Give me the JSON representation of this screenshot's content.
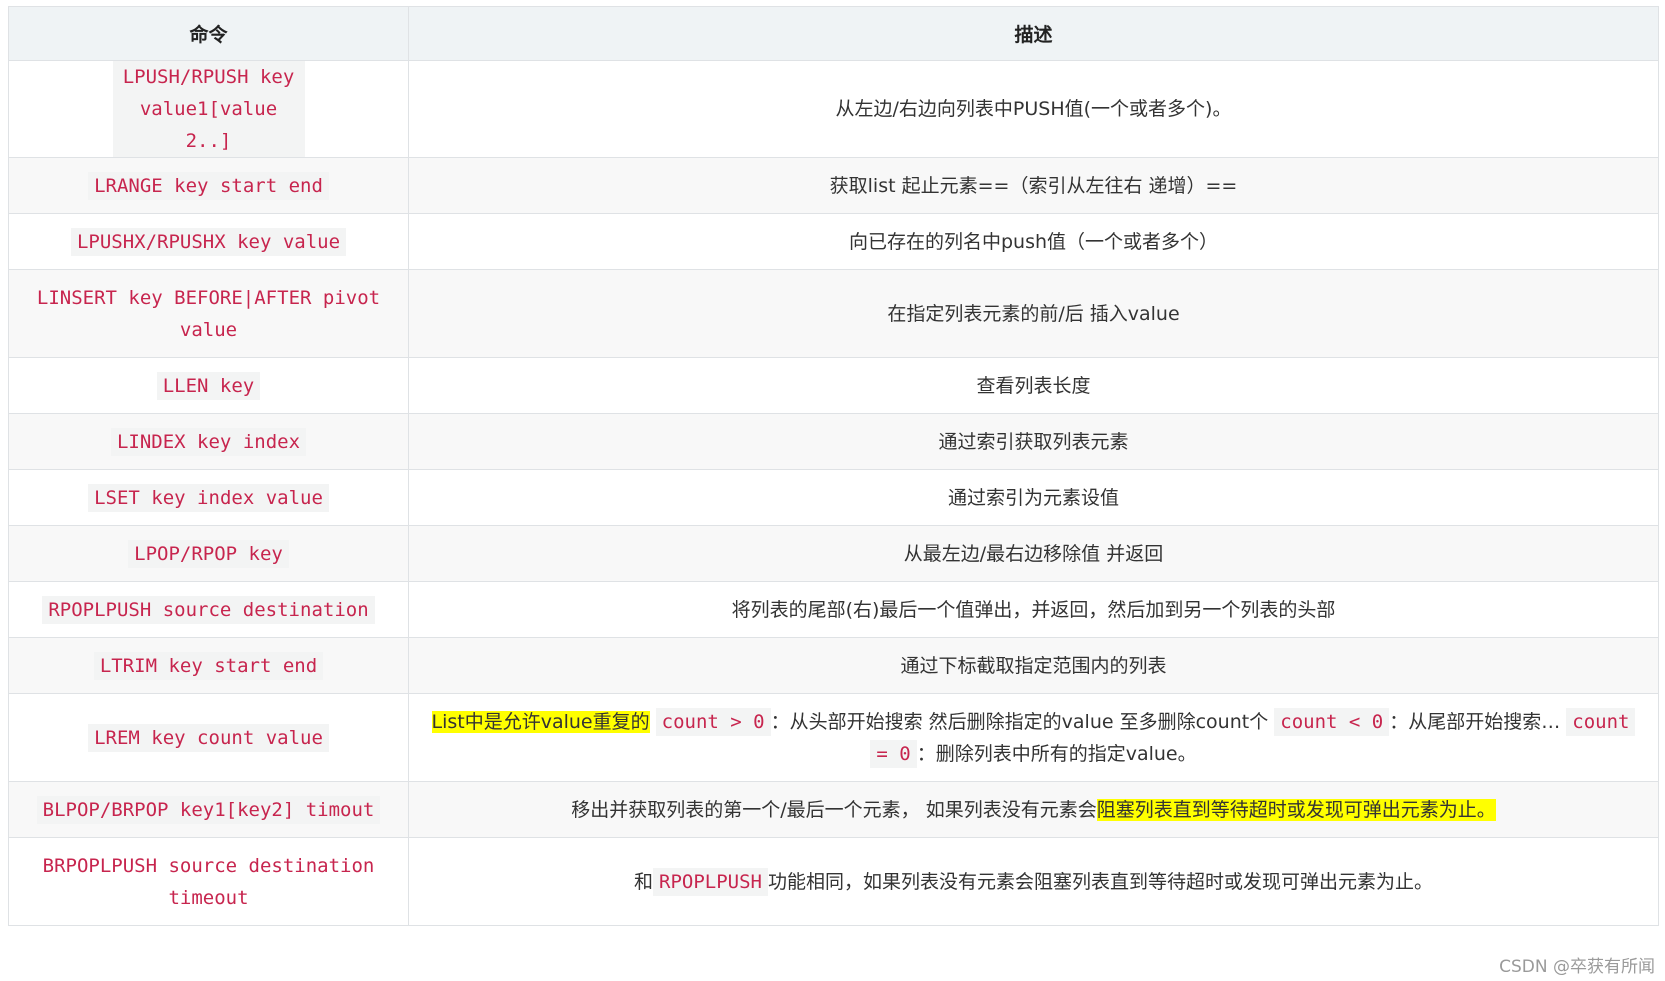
{
  "headers": {
    "command": "命令",
    "description": "描述"
  },
  "rows": [
    {
      "command": "LPUSH/RPUSH key value1[value2..]",
      "description": "从左边/右边向列表中PUSH值(一个或者多个)。"
    },
    {
      "command": "LRANGE key start end",
      "description": "获取list 起止元素==（索引从左往右 递增）=="
    },
    {
      "command": "LPUSHX/RPUSHX key value",
      "description": "向已存在的列名中push值（一个或者多个）"
    },
    {
      "command": "LINSERT key BEFORE|AFTER pivot value",
      "description": "在指定列表元素的前/后 插入value"
    },
    {
      "command": "LLEN key",
      "description": "查看列表长度"
    },
    {
      "command": "LINDEX key index",
      "description": "通过索引获取列表元素"
    },
    {
      "command": "LSET key index value",
      "description": "通过索引为元素设值"
    },
    {
      "command": "LPOP/RPOP key",
      "description": "从最左边/最右边移除值 并返回"
    },
    {
      "command": "RPOPLPUSH source destination",
      "description": "将列表的尾部(右)最后一个值弹出，并返回，然后加到另一个列表的头部"
    },
    {
      "command": "LTRIM key start end",
      "description": "通过下标截取指定范围内的列表"
    },
    {
      "command": "LREM key count value",
      "desc_parts": {
        "highlight": "List中是允许value重复的",
        "code1": "count > 0",
        "text1": "：从头部开始搜索 然后删除指定的value 至多删除count个",
        "code2": "count < 0",
        "text2": "：从尾部开始搜索…",
        "code3": "count = 0",
        "text3": "：删除列表中所有的指定value。"
      }
    },
    {
      "command": "BLPOP/BRPOP key1[key2] timout",
      "desc_parts": {
        "text1": "移出并获取列表的第一个/最后一个元素， 如果列表没有元素会",
        "highlight": "阻塞列表直到等待超时或发现可弹出元素为止。"
      }
    },
    {
      "command": "BRPOPLPUSH source destination timeout",
      "desc_parts": {
        "text1": "和",
        "code1": "RPOPLPUSH",
        "text2": "功能相同，如果列表没有元素会阻塞列表直到等待超时或发现可弹出元素为止。"
      }
    }
  ],
  "watermark": "CSDN @卒获有所闻"
}
